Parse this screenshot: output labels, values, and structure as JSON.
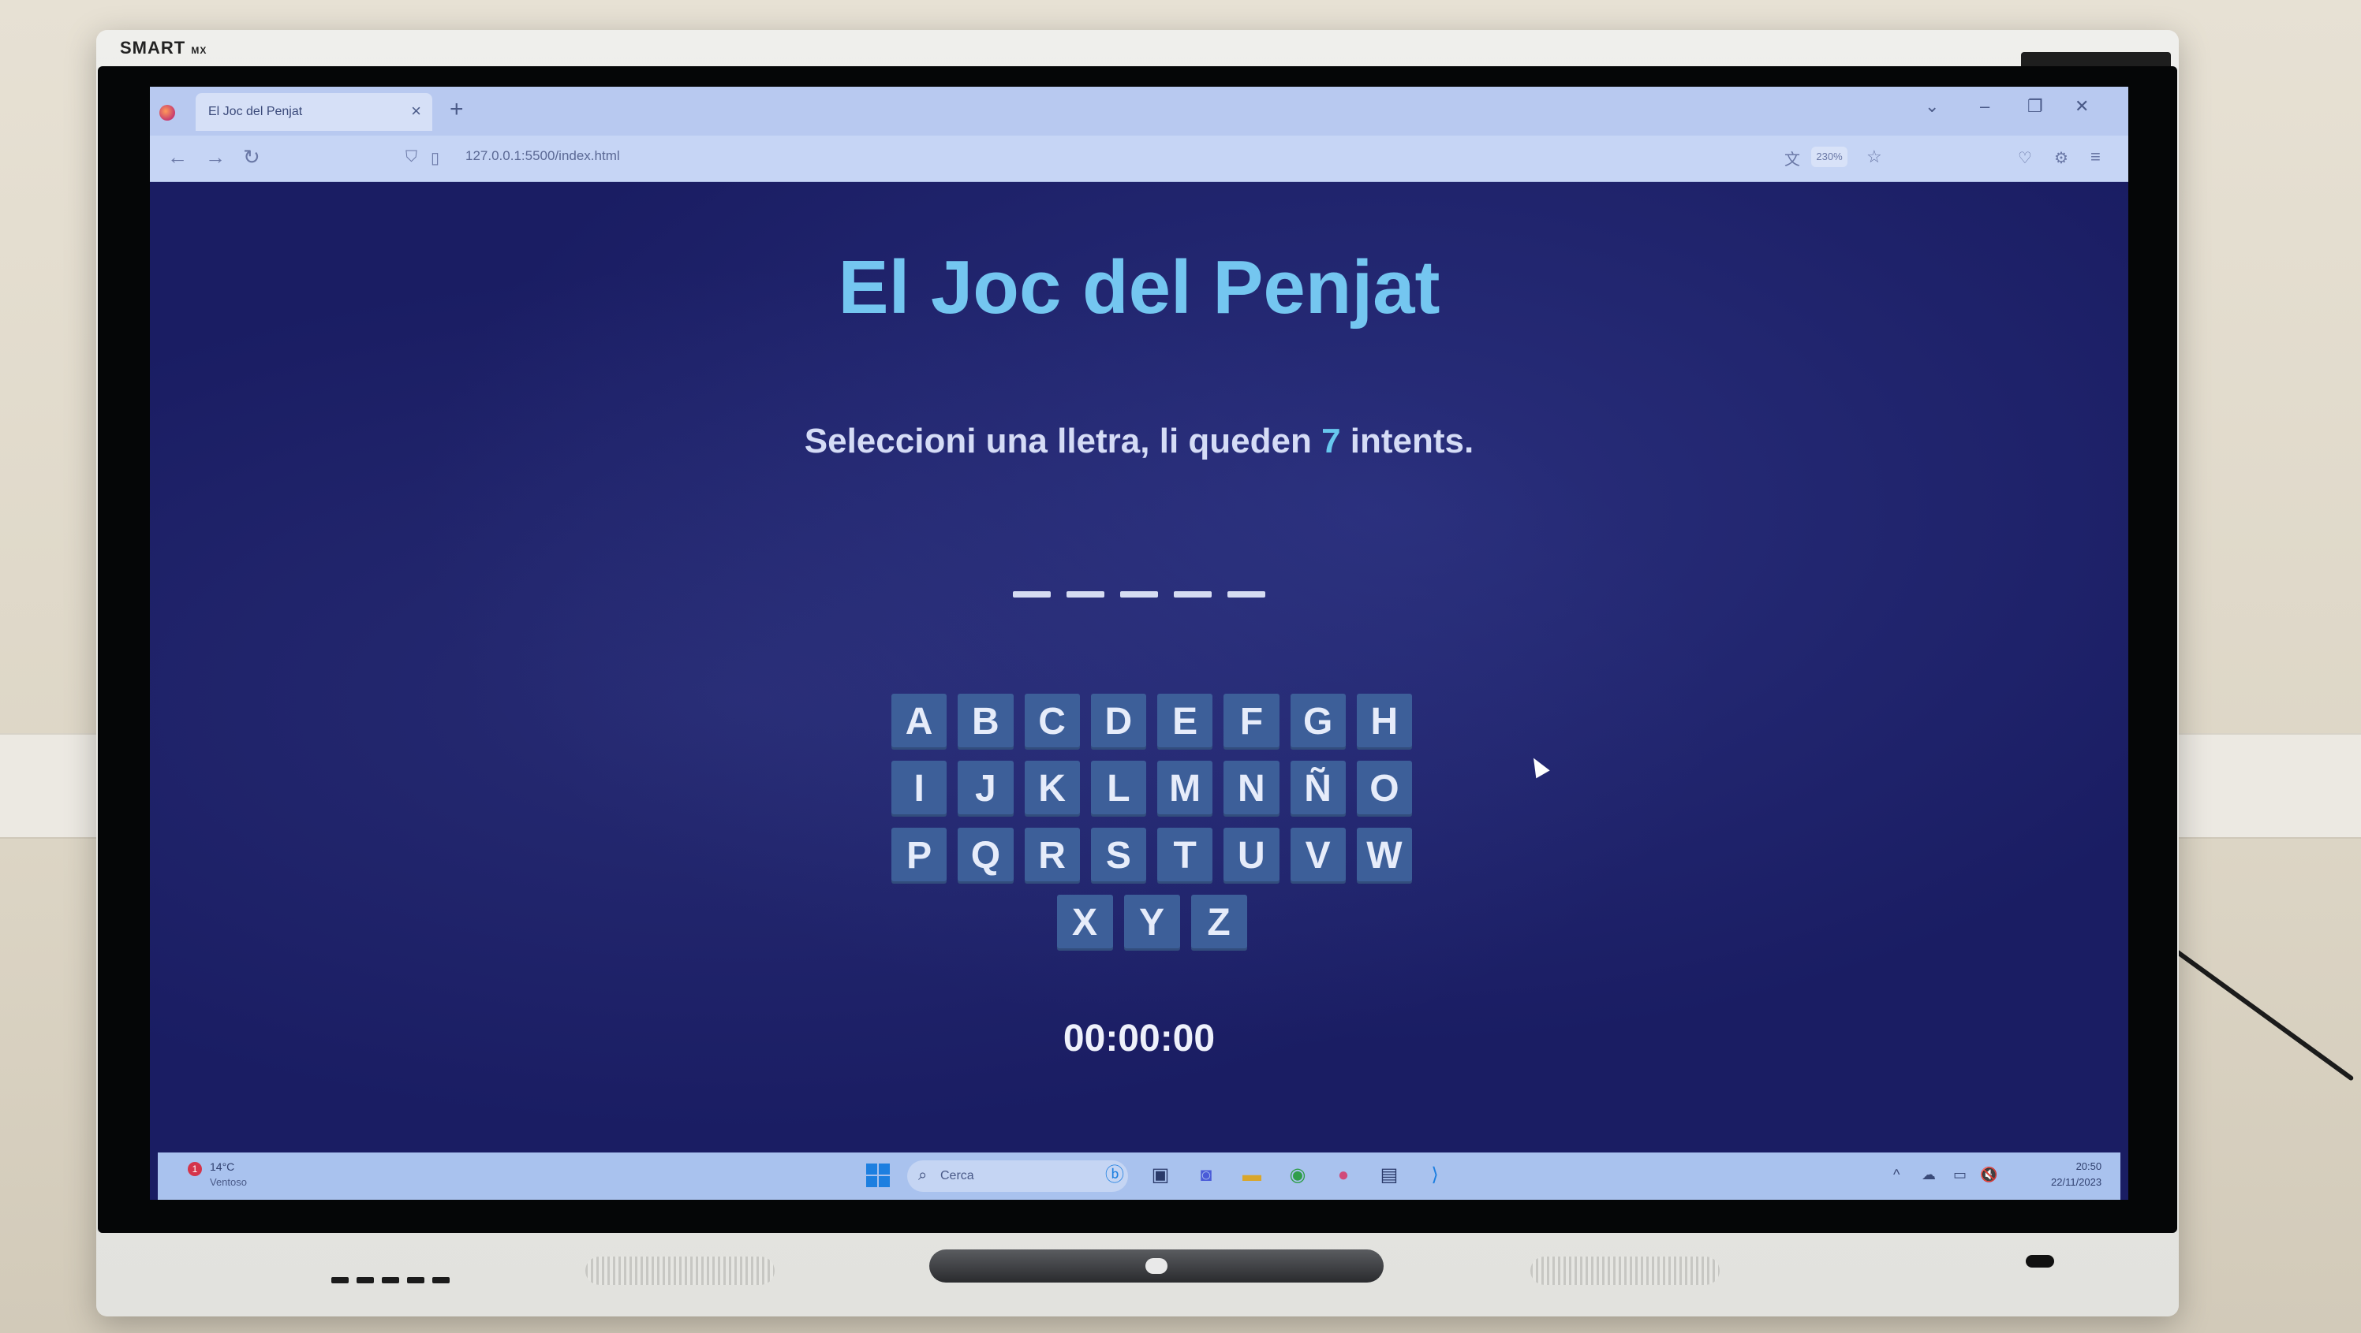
{
  "monitor": {
    "brand": "SMART",
    "brand_model": "MX"
  },
  "browser": {
    "tab_title": "El Joc del Penjat",
    "new_tab": "+",
    "url": "127.0.0.1:5500/index.html",
    "zoom": "230%"
  },
  "page": {
    "title": "El Joc del Penjat",
    "status_prefix": "Seleccioni una lletra, li queden ",
    "attempts": "7",
    "status_suffix": " intents.",
    "word_length": 5,
    "keyboard_rows": [
      [
        "A",
        "B",
        "C",
        "D",
        "E",
        "F",
        "G",
        "H"
      ],
      [
        "I",
        "J",
        "K",
        "L",
        "M",
        "N",
        "Ñ",
        "O"
      ],
      [
        "P",
        "Q",
        "R",
        "S",
        "T",
        "U",
        "V",
        "W"
      ],
      [
        "X",
        "Y",
        "Z"
      ]
    ],
    "timer": "00:00:00"
  },
  "taskbar": {
    "weather_badge": "1",
    "weather_temp": "14°C",
    "weather_desc": "Ventoso",
    "search_placeholder": "Cerca",
    "time": "20:50",
    "date": "22/11/2023"
  }
}
